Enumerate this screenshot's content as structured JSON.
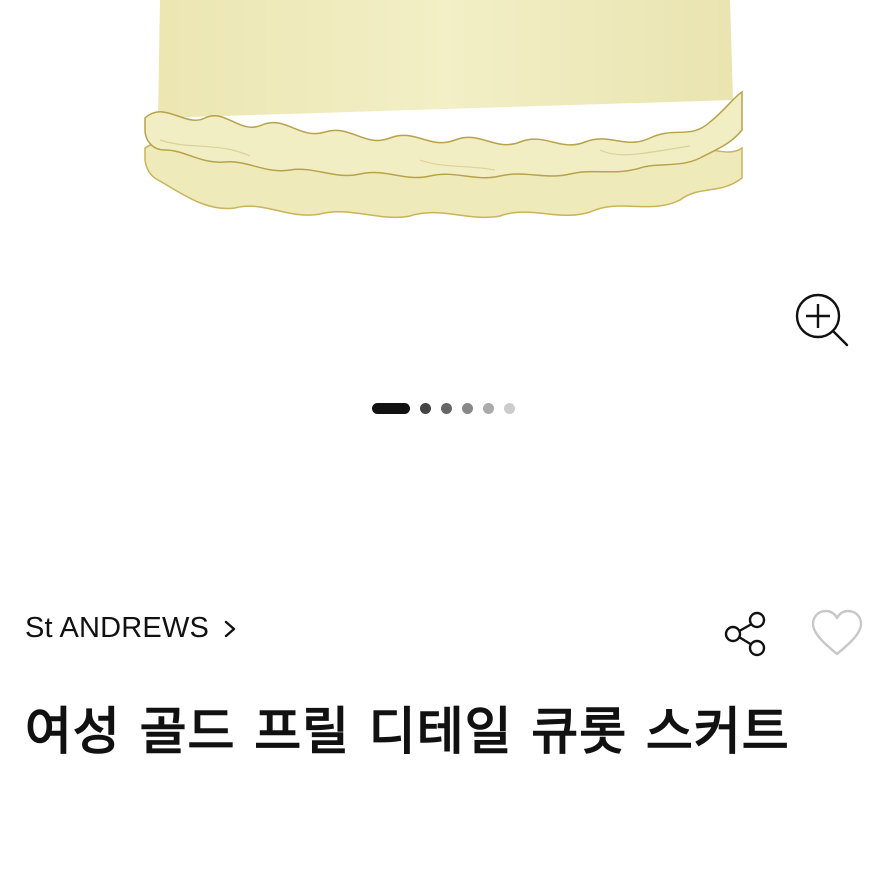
{
  "product": {
    "brand": "St ANDREWS",
    "title": "여성 골드 프릴 디테일 큐롯 스커트"
  },
  "gallery": {
    "slide_count": 6,
    "active_index": 0,
    "skirt_color": "#f0ecbe",
    "trim_color": "#b8a24a"
  },
  "icons": {
    "zoom": "zoom-in-icon",
    "brand_arrow": "chevron-right-icon",
    "share": "share-icon",
    "like": "heart-outline-icon"
  }
}
